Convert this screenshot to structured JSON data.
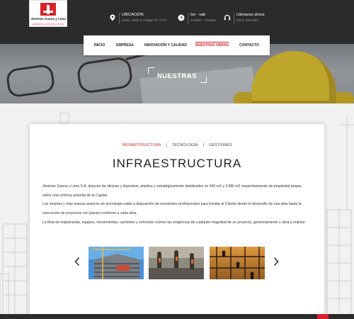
{
  "brand": {
    "name": "Jiménez Gaona y Lima",
    "tagline": "EMPRESA CONSTRUCTORA",
    "accent_color": "#d8232a"
  },
  "header": {
    "location": {
      "icon": "location-pin-icon",
      "title": "UBICACIÓN",
      "detail": "Avda. José G Artigas Nº 1777"
    },
    "hours": {
      "icon": "clock-icon",
      "title": "lun - sab",
      "detail": "0:00am - 0:00pm"
    },
    "phone": {
      "icon": "headset-icon",
      "title": "Llámanos ahora",
      "detail": "(021) 210-684"
    }
  },
  "nav": {
    "items": [
      {
        "label": "Inicio"
      },
      {
        "label": "Empresa"
      },
      {
        "label": "Innovación y Calidad"
      },
      {
        "label": "Nuestras Obras"
      },
      {
        "label": "Contacto"
      }
    ],
    "active_index": 3
  },
  "hero": {
    "title": "NUESTRAS"
  },
  "content": {
    "tabs": [
      {
        "label": "INFRAESTRUCTURA"
      },
      {
        "label": "TECNOLOGÍA"
      },
      {
        "label": "GESTIONES"
      }
    ],
    "tab_separator": "|",
    "active_tab": 0,
    "title": "INFRAESTRUCTURA",
    "paragraphs": [
      "Jiménez Gaona y Lima S.A. dispone de oficinas y depósitos, amplios y estratégicamente distribuidos en 560 m2 y 3.990 m2 respectivamente de propiedad propia, sobre una céntrica avenida de la Capital.",
      "Los mejores y más nuevos avances de tecnología están a disposición de excelentes profesionales para brindar al Cliente desde el desarrollo de una idea hasta la concreción de proyectos con planeo conforme a cada obra.",
      "La flota de maquinarias, equipos, herramientas, camiones y vehículos reúnen las exigencias de cualquier magnitud de un proyecto, gerenciamiento y obra a realizar."
    ],
    "gallery": {
      "prev_icon": "chevron-left-icon",
      "next_icon": "chevron-right-icon",
      "photos": [
        "building-construction-photo",
        "road-workers-photo",
        "scaffolding-workers-photo"
      ]
    }
  }
}
